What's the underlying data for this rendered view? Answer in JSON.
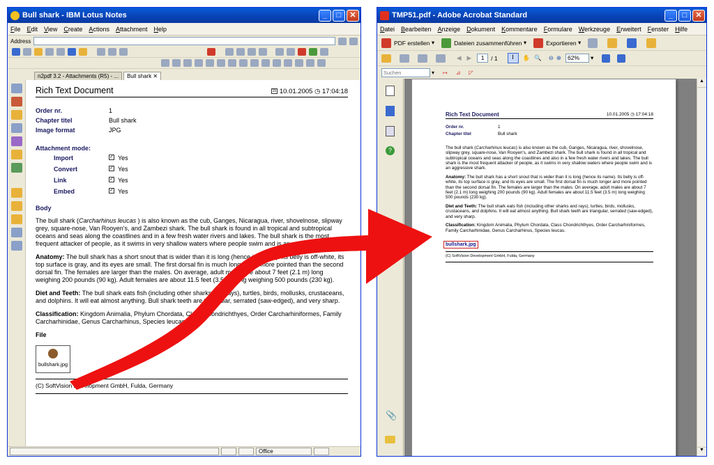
{
  "notes": {
    "title": "Bull shark - IBM Lotus Notes",
    "menu": [
      "File",
      "Edit",
      "View",
      "Create",
      "Actions",
      "Attachment",
      "Help"
    ],
    "address_label": "Address",
    "tabs": [
      "n2pdf 3.2 - Attachments (R5) - ...",
      "Bull shark"
    ],
    "doc": {
      "title": "Rich Text Document",
      "date": "10.01.2005",
      "time": "17:04:18",
      "fields": [
        {
          "label": "Order nr.",
          "value": "1"
        },
        {
          "label": "Chapter titel",
          "value": "Bull shark"
        },
        {
          "label": "Image format",
          "value": "JPG"
        }
      ],
      "attachment_mode_label": "Attachment mode:",
      "attachment_modes": [
        {
          "label": "Import",
          "value": "Yes"
        },
        {
          "label": "Convert",
          "value": "Yes"
        },
        {
          "label": "Link",
          "value": "Yes"
        },
        {
          "label": "Embed",
          "value": "Yes"
        }
      ],
      "body_label": "Body",
      "para1_a": "The bull shark (",
      "para1_italic": "Carcharhinus leucas",
      "para1_b": " ) is also known as the cub, Ganges, Nicaragua, river, shovelnose, slipway grey, square-nose, Van Rooyen's, and Zambezi shark. The bull shark is found in all tropical and subtropical oceans and seas along the coastlines and in a few fresh water rivers and lakes. The bull shark is the most frequent attacker of people, as it swims in very shallow waters where people swim and is an aggressive shark.",
      "anatomy_label": "Anatomy:",
      "anatomy_text": " The bull shark has a short snout that is wider than it is long (hence its name). Its belly is off-white, its top surface is gray, and its eyes are small. The first dorsal fin is much longer and more pointed than the second dorsal fin. The females are larger than the males. On average, adult males are about 7 feet (2.1 m) long weighing 200 pounds (90 kg). Adult females are about 11.5 feet (3.5 m) long weighing 500 pounds (230 kg).",
      "diet_label": "Diet and Teeth:",
      "diet_text": " The bull shark eats fish (including other sharks and rays), turtles, birds, mollusks, crustaceans, and dolphins. It will eat almost anything. Bull shark teeth are triangular, serrated (saw-edged), and very sharp.",
      "class_label": "Classification:",
      "class_text": " Kingdom Animalia, Phylum Chordata, Class Chondrichthyes, Order Carcharhiniformes, Family Carcharhinidae, Genus Carcharhinus, Species leucas.",
      "file_label": "File",
      "file_name": "bullshark.jpg",
      "footer": "(C) SoftVision Development GmbH, Fulda, Germany"
    },
    "status_office": "Office"
  },
  "acrobat": {
    "title": "TMP51.pdf - Adobe Acrobat Standard",
    "menu": [
      "Datei",
      "Bearbeiten",
      "Anzeige",
      "Dokument",
      "Kommentare",
      "Formulare",
      "Werkzeuge",
      "Erweitert",
      "Fenster",
      "Hilfe"
    ],
    "toolbar": {
      "pdf_create": "PDF erstellen",
      "combine": "Dateien zusammenführen",
      "export": "Exportieren"
    },
    "page_current": "1",
    "page_total": "/ 1",
    "zoom": "62%",
    "search_placeholder": "Suchen",
    "pdf": {
      "title": "Rich Text Document",
      "datetime": "10.01.2005 ◷ 17:04:18",
      "order_label": "Order nr.",
      "order_value": "1",
      "chapter_label": "Chapter titel",
      "chapter_value": "Bull shark",
      "para1_a": "The bull shark (",
      "para1_italic": "Carcharhinus leucas",
      "para1_b": ") is also known as the cub, Ganges, Nicaragua, river, shovelnose, slipway grey, square-nose, Van Rooyen's, and Zambezi shark. The bull shark is found in all tropical and subtropical oceans and seas along the coastlines and also in a few fresh water rivers and lakes. The bull shark is the most frequent attacker of people, as it swims in very shallow waters where people swim and is an aggressive shark.",
      "anatomy_label": "Anatomy:",
      "anatomy_text": " The bull shark has a short snout that is wider than it is long (hence its name). Its belly is off-white, its top surface is gray, and its eyes are small. The first dorsal fin is much longer and more pointed than the second dorsal fin. The females are larger than the males. On average, adult males are about 7 feet (2.1 m) long weighing 200 pounds (90 kg). Adult females are about 11.5 feet (3.5 m) long weighing 500 pounds (230 kg).",
      "diet_label": "Diet and Teeth:",
      "diet_text": " The bull shark eats fish (including other sharks and rays), turtles, birds, mollusks, crustaceans, and dolphins. It will eat almost anything. Bull shark teeth are triangular, serrated (saw-edged), and very sharp.",
      "class_label": "Classification:",
      "class_text": " Kingdom Animalia, Phylum Chordata, Class Chondrichthyes, Order Carcharhiniformes, Family Carcharhinidae, Genus Carcharhinus, Species leucas.",
      "link": "bullshark.jpg",
      "footer": "(C) SoftVision Development GmbH, Fulda, Germany"
    }
  },
  "colors": {
    "arrow": "#ee1111",
    "titlebar": "#0a5ad8",
    "label_blue": "#1a1a60"
  }
}
